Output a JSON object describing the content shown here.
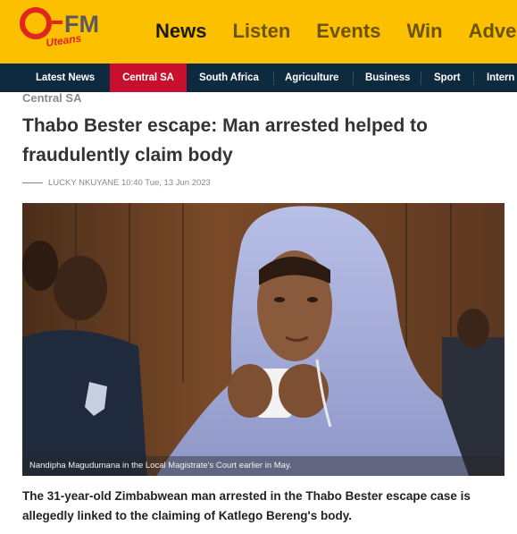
{
  "brand": {
    "logo_text": "OFM",
    "logo_tagline": "Uteans",
    "colors": {
      "header_bg": "#fcc000",
      "logo_red": "#e2261d",
      "subnav_bg": "#0d2a3e",
      "active_tab": "#c8102e"
    }
  },
  "main_nav": {
    "items": [
      "News",
      "Listen",
      "Events",
      "Win",
      "Adver"
    ]
  },
  "sub_nav": {
    "tabs": [
      "Latest News",
      "Central SA",
      "South Africa",
      "Agriculture",
      "Business",
      "Sport",
      "Intern"
    ],
    "active": "Central SA"
  },
  "article": {
    "section": "Central SA",
    "headline": "Thabo Bester escape: Man arrested helped to fraudulently claim body",
    "byline": "LUCKY NKUYANE 10:40 Tue, 13 Jun 2023",
    "image": {
      "caption": "Nandipha Magudumana in the Local Magistrate's Court earlier in May."
    },
    "lede": "The 31-year-old Zimbabwean man arrested in the Thabo Bester escape case is allegedly linked to the claiming of Katlego Bereng's body."
  }
}
